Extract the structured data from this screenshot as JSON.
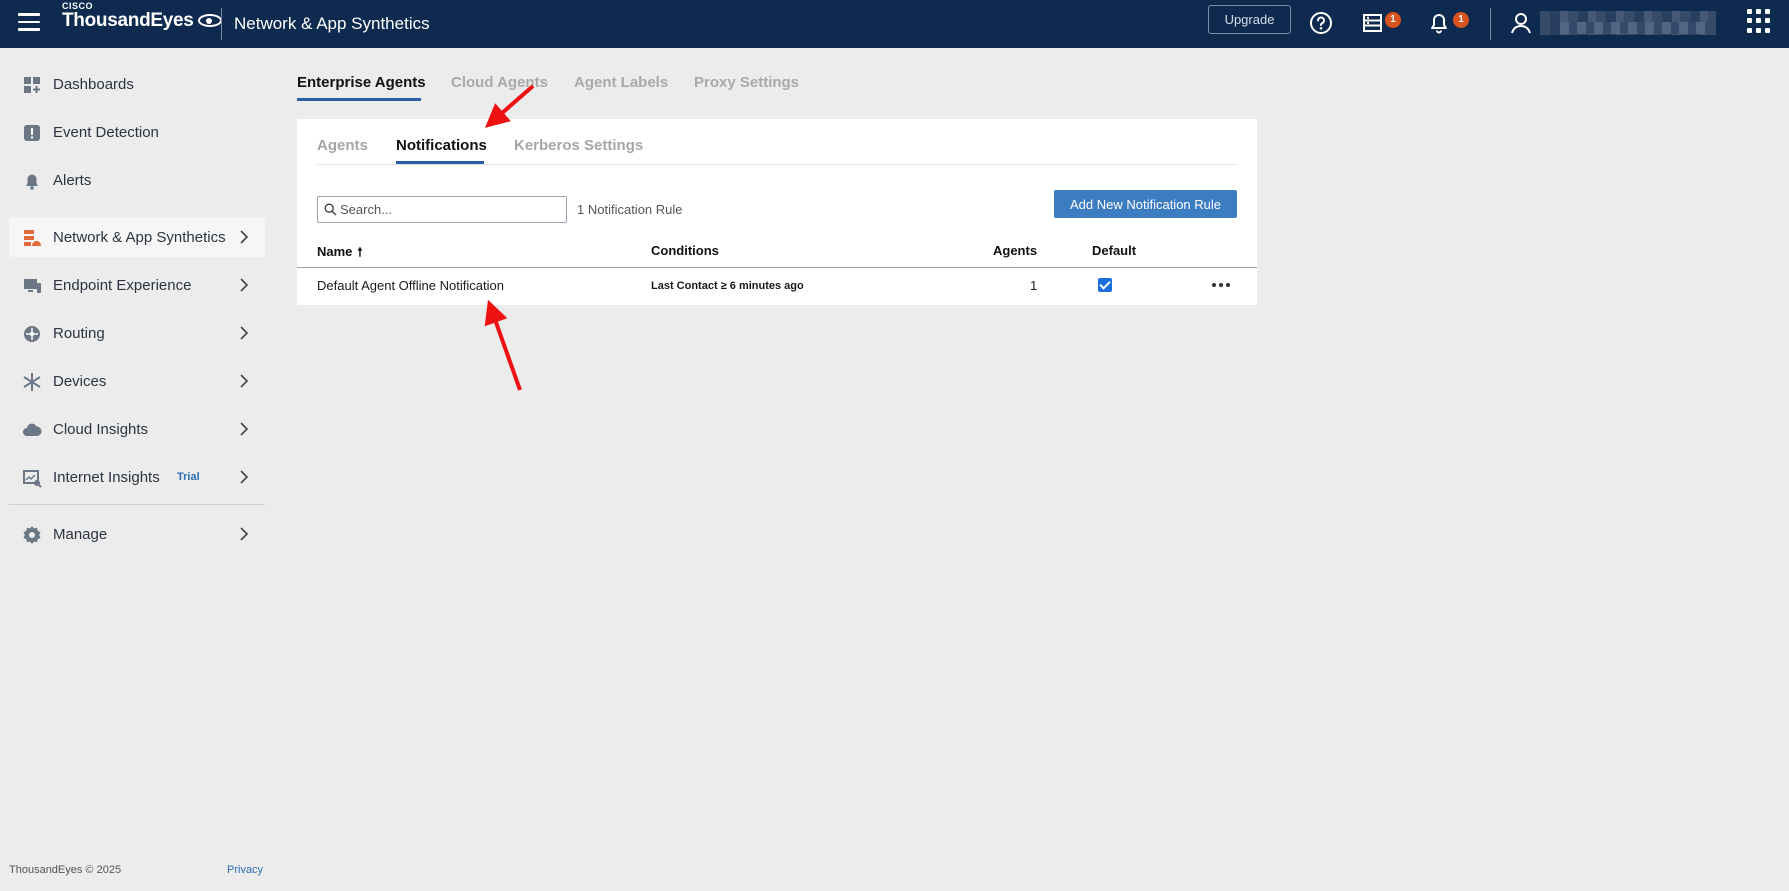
{
  "header": {
    "brand_small": "CISCO",
    "brand": "ThousandEyes",
    "product_title": "Network & App Synthetics",
    "upgrade_label": "Upgrade",
    "test_badge": "1",
    "alerts_badge": "1"
  },
  "sidebar": {
    "items": [
      {
        "label": "Dashboards",
        "icon": "dashboards-icon",
        "chevron": false
      },
      {
        "label": "Event Detection",
        "icon": "event-detection-icon",
        "chevron": false
      },
      {
        "label": "Alerts",
        "icon": "bell-icon",
        "chevron": false
      },
      {
        "label": "Network & App Synthetics",
        "icon": "network-synthetics-icon",
        "chevron": true,
        "active": true
      },
      {
        "label": "Endpoint Experience",
        "icon": "endpoint-icon",
        "chevron": true
      },
      {
        "label": "Routing",
        "icon": "routing-icon",
        "chevron": true
      },
      {
        "label": "Devices",
        "icon": "devices-icon",
        "chevron": true
      },
      {
        "label": "Cloud Insights",
        "icon": "cloud-icon",
        "chevron": true
      },
      {
        "label": "Internet Insights",
        "icon": "internet-insights-icon",
        "chevron": true,
        "badge": "Trial"
      },
      {
        "label": "Manage",
        "icon": "gear-icon",
        "chevron": true
      }
    ],
    "footer_copyright": "ThousandEyes © 2025",
    "footer_privacy": "Privacy"
  },
  "top_tabs": [
    {
      "label": "Enterprise Agents",
      "active": true
    },
    {
      "label": "Cloud Agents"
    },
    {
      "label": "Agent Labels"
    },
    {
      "label": "Proxy Settings"
    }
  ],
  "sub_tabs": [
    {
      "label": "Agents"
    },
    {
      "label": "Notifications",
      "active": true
    },
    {
      "label": "Kerberos Settings"
    }
  ],
  "search": {
    "placeholder": "Search..."
  },
  "rule_count": "1 Notification Rule",
  "add_button_label": "Add New Notification Rule",
  "table": {
    "headers": {
      "name": "Name",
      "conditions": "Conditions",
      "agents": "Agents",
      "default": "Default"
    },
    "sort_indicator": "🠕",
    "rows": [
      {
        "name": "Default Agent Offline Notification",
        "conditions": "Last Contact ≥ 6 minutes ago",
        "agents": "1",
        "default": true
      }
    ]
  },
  "colors": {
    "topbar": "#0e2a4f",
    "accent": "#2a5fa8",
    "button": "#3c7cc1",
    "badge": "#d9531e",
    "annotation_arrow": "#ee1111"
  }
}
